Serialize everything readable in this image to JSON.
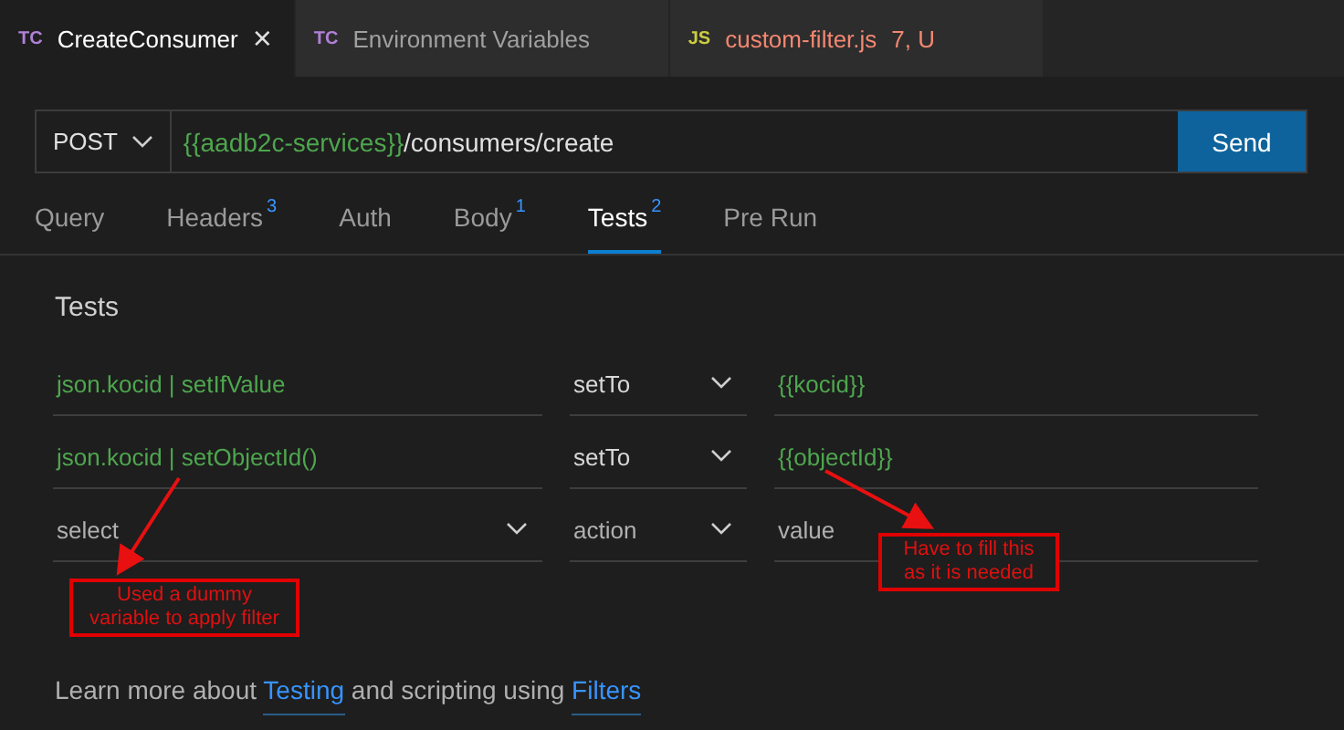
{
  "editor_tabs": [
    {
      "badge": "TC",
      "kind": "collection",
      "label": "CreateConsumer",
      "close": "×",
      "selected": true,
      "error": false
    },
    {
      "badge": "TC",
      "kind": "collection",
      "label": "Environment Variables",
      "selected": false,
      "error": false
    },
    {
      "badge": "JS",
      "kind": "script",
      "label": "custom-filter.js",
      "status": "7, U",
      "selected": false,
      "error": true
    }
  ],
  "request": {
    "method": "POST",
    "url_variable": "{{aadb2c-services}}",
    "url_path": "/consumers/create",
    "send": "Send"
  },
  "request_tabs": [
    {
      "label": "Query",
      "selected": false
    },
    {
      "label": "Headers",
      "count": "3",
      "selected": false
    },
    {
      "label": "Auth",
      "selected": false
    },
    {
      "label": "Body",
      "count": "1",
      "selected": false
    },
    {
      "label": "Tests",
      "count": "2",
      "selected": true
    },
    {
      "label": "Pre Run",
      "selected": false
    }
  ],
  "tests": {
    "title": "Tests",
    "rows": [
      {
        "kind": "entry",
        "filter": "json.kocid | setIfValue",
        "action": "setTo",
        "value": "{{kocid}}"
      },
      {
        "kind": "entry",
        "filter": "json.kocid | setObjectId()",
        "action": "setTo",
        "value": "{{objectId}}"
      },
      {
        "kind": "blank",
        "filter_placeholder": "select",
        "action_placeholder": "action",
        "value_placeholder": "value"
      }
    ]
  },
  "help": [
    {
      "kind": "text",
      "text": "Learn more about "
    },
    {
      "kind": "link",
      "text": "Testing"
    },
    {
      "kind": "text",
      "text": " and scripting using "
    },
    {
      "kind": "link",
      "text": "Filters"
    }
  ],
  "annotations": [
    {
      "text": "Used a dummy variable to apply filter"
    },
    {
      "text": "Have to fill this as it is needed"
    }
  ]
}
